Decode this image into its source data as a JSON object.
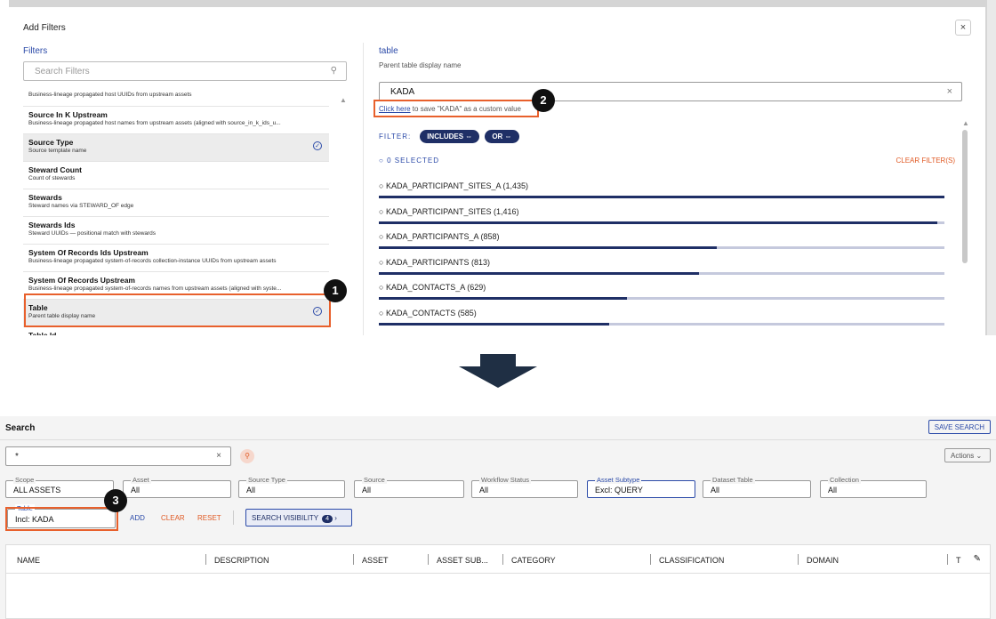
{
  "modal": {
    "title": "Add Filters",
    "close": "×",
    "filters_heading": "Filters",
    "search_placeholder": "Search Filters",
    "list": [
      {
        "name": "",
        "desc": "Business-lineage propagated host UUIDs from upstream assets",
        "selected": false
      },
      {
        "name": "Source In K Upstream",
        "desc": "Business-lineage propagated host names from upstream assets (aligned with source_in_k_ids_u...",
        "selected": false
      },
      {
        "name": "Source Type",
        "desc": "Source template name",
        "selected": true
      },
      {
        "name": "Steward Count",
        "desc": "Count of stewards",
        "selected": false
      },
      {
        "name": "Stewards",
        "desc": "Steward names via STEWARD_OF edge",
        "selected": false
      },
      {
        "name": "Stewards Ids",
        "desc": "Steward UUIDs — positional match with stewards",
        "selected": false
      },
      {
        "name": "System Of Records Ids Upstream",
        "desc": "Business-lineage propagated system-of-records collection-instance UUIDs from upstream assets",
        "selected": false
      },
      {
        "name": "System Of Records Upstream",
        "desc": "Business-lineage propagated system-of-records names from upstream assets (aligned with syste...",
        "selected": false
      },
      {
        "name": "Table",
        "desc": "Parent table display name",
        "selected": true
      },
      {
        "name": "Table Id",
        "desc": "",
        "selected": false
      }
    ],
    "right": {
      "title": "table",
      "subtitle": "Parent table display name",
      "input_value": "KADA",
      "clear": "×",
      "click_here": "Click here",
      "click_here_rest": " to save \"KADA\" as a custom value",
      "filter_label": "FILTER:",
      "includes": "INCLUDES ⇔",
      "or": "OR ⇔",
      "selected": "0 SELECTED",
      "clear_filters": "CLEAR FILTER(S)",
      "values": [
        {
          "label": "KADA_PARTICIPANT_SITES_A (1,435)",
          "count": 1435
        },
        {
          "label": "KADA_PARTICIPANT_SITES (1,416)",
          "count": 1416
        },
        {
          "label": "KADA_PARTICIPANTS_A (858)",
          "count": 858
        },
        {
          "label": "KADA_PARTICIPANTS (813)",
          "count": 813
        },
        {
          "label": "KADA_CONTACTS_A (629)",
          "count": 629
        },
        {
          "label": "KADA_CONTACTS (585)",
          "count": 585
        }
      ]
    }
  },
  "badges": {
    "b1": "1",
    "b2": "2",
    "b3": "3"
  },
  "search": {
    "title": "Search",
    "save_search": "SAVE SEARCH",
    "query": "*",
    "query_clear": "×",
    "actions": "Actions ⌄",
    "dropdowns": [
      {
        "label": "Scope",
        "value": "ALL ASSETS"
      },
      {
        "label": "Asset",
        "value": "All"
      },
      {
        "label": "Source Type",
        "value": "All"
      },
      {
        "label": "Source",
        "value": "All"
      },
      {
        "label": "Workflow Status",
        "value": "All"
      },
      {
        "label": "Asset Subtype",
        "value": "Excl: QUERY"
      },
      {
        "label": "Dataset Table",
        "value": "All"
      },
      {
        "label": "Collection",
        "value": "All"
      }
    ],
    "table_filter": {
      "label": "Table",
      "value": "Incl: KADA"
    },
    "add": "ADD",
    "clear": "CLEAR",
    "reset": "RESET",
    "search_visibility": "SEARCH VISIBILITY",
    "visibility_count": "4",
    "columns": [
      "NAME",
      "DESCRIPTION",
      "ASSET",
      "ASSET SUB...",
      "CATEGORY",
      "CLASSIFICATION",
      "DOMAIN",
      "T"
    ]
  },
  "colors": {
    "accent": "#2b4aa8",
    "navy": "#1f2f66",
    "highlight": "#e8602c"
  }
}
